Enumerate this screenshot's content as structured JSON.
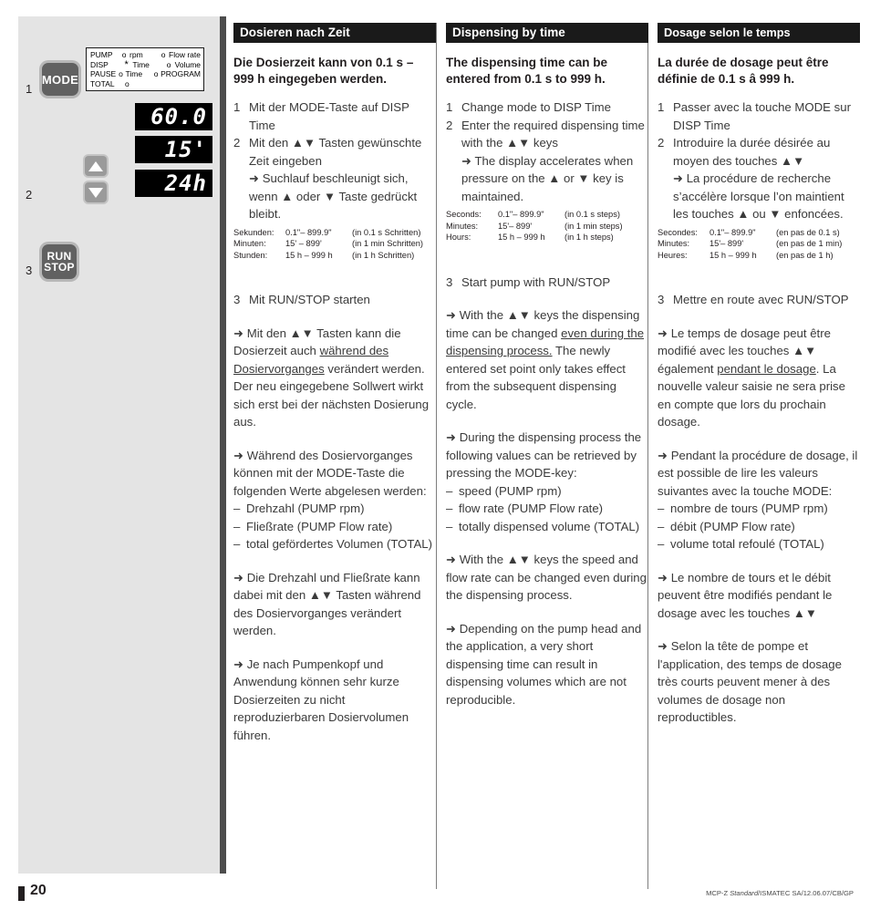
{
  "illustration": {
    "steps": [
      "1",
      "2",
      "3"
    ],
    "buttons": {
      "mode": "MODE",
      "run": "RUN",
      "stop": "STOP",
      "up_icon": "triangle-up-icon",
      "down_icon": "triangle-down-icon"
    },
    "mode_panel": {
      "rows": [
        {
          "label": "PUMP",
          "dot1": "o",
          "opt1": "rpm",
          "dot2": "o",
          "opt2": "Flow rate"
        },
        {
          "label": "DISP",
          "dot1": "*",
          "opt1": "Time",
          "dot2": "o",
          "opt2": "Volume"
        },
        {
          "label": "PAUSE",
          "dot1": "o",
          "opt1": "Time",
          "dot2": "o",
          "opt2": "PROGRAM"
        },
        {
          "label": "TOTAL",
          "dot1": "o",
          "opt1": "",
          "dot2": "",
          "opt2": ""
        }
      ]
    },
    "displays": [
      "60.0",
      "15'",
      "24h"
    ]
  },
  "de": {
    "heading": "Dosieren nach Zeit",
    "lead": "Die Dosierzeit kann von 0.1 s – 999 h eingegeben werden.",
    "step1_idx": "1",
    "step1": "Mit der MODE-Taste auf DISP Time",
    "step2_idx": "2",
    "step2_a": "Mit den ▲▼ Tasten gewünschte Zeit eingeben",
    "step2_b": "➜ Suchlauf beschleunigt sich, wenn ▲ oder ▼ Taste gedrückt bleibt.",
    "table": [
      {
        "c1": "Sekunden:",
        "c2": "0.1\"– 899.9\"",
        "c3": "(in 0.1 s Schritten)"
      },
      {
        "c1": "Minuten:",
        "c2": "15' – 899'",
        "c3": "(in 1 min Schritten)"
      },
      {
        "c1": "Stunden:",
        "c2": "15 h – 999 h",
        "c3": "(in 1 h Schritten)"
      }
    ],
    "step3_idx": "3",
    "step3": "Mit RUN/STOP starten",
    "p1_pre": "➜ Mit den ▲▼ Tasten kann die Dosierzeit auch ",
    "p1_u": "während des Dosiervorganges",
    "p1_post": " verändert werden. Der neu eingegebene Sollwert wirkt sich erst bei der nächsten Dosierung aus.",
    "p2": "➜ Während des Dosiervorganges können mit der MODE-Taste die folgenden Werte abgelesen werden:",
    "list": [
      "Drehzahl (PUMP rpm)",
      "Fließrate (PUMP Flow rate)",
      "total gefördertes Volumen (TOTAL)"
    ],
    "p3": "➜ Die Drehzahl und Fließrate kann dabei mit den ▲▼ Tasten während des Dosiervorganges verändert werden.",
    "p4": "➜ Je nach Pumpenkopf und Anwendung können sehr kurze Dosierzeiten zu nicht reproduzierbaren Dosiervolumen führen."
  },
  "en": {
    "heading": "Dispensing by time",
    "lead": "The dispensing time can be entered from 0.1 s to 999 h.",
    "step1_idx": "1",
    "step1": "Change mode to DISP Time",
    "step2_idx": "2",
    "step2_a": "Enter the required dispensing time with the ▲▼ keys",
    "step2_b": "➜ The display accelerates when pressure on the ▲ or ▼ key is maintained.",
    "table": [
      {
        "c1": "Seconds:",
        "c2": "0.1\"– 899.9\"",
        "c3": "(in 0.1 s steps)"
      },
      {
        "c1": "Minutes:",
        "c2": "15'– 899'",
        "c3": "(in 1 min steps)"
      },
      {
        "c1": "Hours:",
        "c2": "15 h – 999 h",
        "c3": "(in 1 h steps)"
      }
    ],
    "step3_idx": "3",
    "step3": "Start pump with RUN/STOP",
    "p1_pre": "➜ With the ▲▼ keys the dispensing time can be changed ",
    "p1_u": "even during the dispensing process.",
    "p1_post": " The newly entered set point only takes effect from the subsequent dispensing cycle.",
    "p2": "➜ During the dispensing process the following values can be retrieved by pressing the MODE-key:",
    "list": [
      "speed (PUMP rpm)",
      "flow rate (PUMP Flow rate)",
      "totally dispensed volume (TOTAL)"
    ],
    "p3": "➜ With the ▲▼ keys the speed and flow rate can be changed even during the dispensing process.",
    "p4": "➜ Depending on the pump head and the application, a very short dispensing time can result in dispensing volumes which are not reproducible."
  },
  "fr": {
    "heading": "Dosage selon le temps",
    "lead": "La durée de dosage peut être définie de 0.1 s â  999 h.",
    "step1_idx": "1",
    "step1": "Passer avec la touche MODE sur DISP Time",
    "step2_idx": "2",
    "step2_a": "Introduire la durée désirée au moyen des touches ▲▼",
    "step2_b": "➜ La procédure de recherche s’accélère lorsque l’on maintient les touches ▲  ou ▼ enfoncées.",
    "table": [
      {
        "c1": "Secondes:",
        "c2": "0.1\"– 899.9\"",
        "c3": "(en pas de 0.1 s)"
      },
      {
        "c1": "Minutes:",
        "c2": "15'– 899'",
        "c3": "(en pas de 1 min)"
      },
      {
        "c1": "Heures:",
        "c2": "15 h – 999 h",
        "c3": "(en pas de 1 h)"
      }
    ],
    "step3_idx": "3",
    "step3": "Mettre en route avec RUN/STOP",
    "p1_pre": "➜ Le temps de dosage peut être modifié avec les touches ▲▼ également ",
    "p1_u": "pendant le dosage",
    "p1_post": ". La nouvelle valeur saisie ne sera prise en compte que lors du prochain dosage.",
    "p2": "➜ Pendant la procédure de dosage, il est possible de lire les valeurs suivantes avec la touche MODE:",
    "list": [
      "nombre de tours (PUMP rpm)",
      "débit (PUMP Flow rate)",
      "volume total refoulé (TOTAL)"
    ],
    "p3": "➜ Le nombre de tours et le débit peuvent être modifiés pendant le dosage avec les touches ▲▼",
    "p4": "➜ Selon la tête de pompe et l'application, des temps de dosage très courts peuvent mener à des volumes de dosage non reproductibles."
  },
  "footer": {
    "page_number": "20",
    "meta_part1": "MCP-Z ",
    "meta_italic": "Standard",
    "meta_part2": "/ISMATEC SA/12.06.07/CB/GP"
  }
}
